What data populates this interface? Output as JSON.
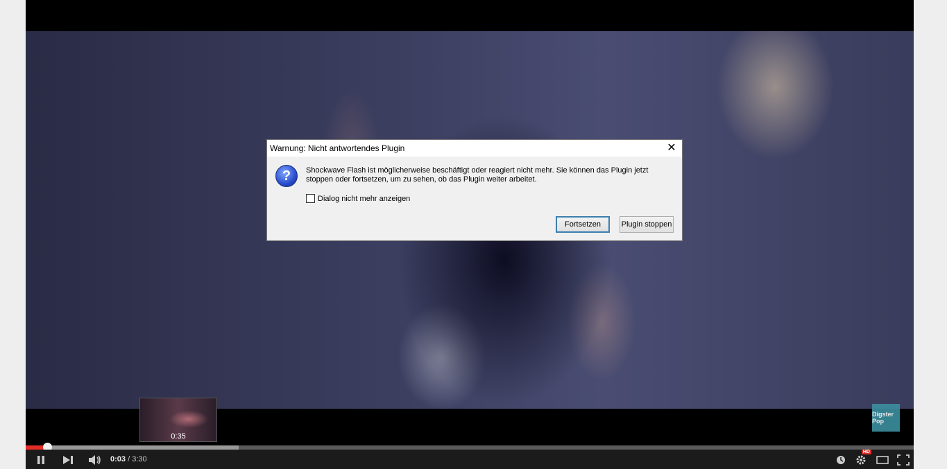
{
  "video": {
    "hover_preview_time": "0:35",
    "watermark_text": "Digster Pop",
    "progress": {
      "played_fraction": 0.024,
      "buffered_fraction": 0.24
    }
  },
  "controls": {
    "current_time": "0:03",
    "separator": " / ",
    "duration": "3:30",
    "hd_badge": "HD",
    "icons": [
      "pause-icon",
      "next-icon",
      "volume-icon",
      "watch-later-icon",
      "gear-icon",
      "theater-mode-icon",
      "fullscreen-icon"
    ]
  },
  "dialog": {
    "title": "Warnung: Nicht antwortendes Plugin",
    "message": "Shockwave Flash ist möglicherweise beschäftigt oder reagiert nicht mehr. Sie können das Plugin jetzt stoppen oder fortsetzen, um zu sehen, ob das Plugin weiter arbeitet.",
    "checkbox_label": "Dialog nicht mehr anzeigen",
    "checkbox_checked": false,
    "continue_label": "Fortsetzen",
    "stop_label": "Plugin stoppen",
    "icon": "question-icon"
  },
  "colors": {
    "progress_played": "#e52d27",
    "dialog_bg": "#f0f0f0",
    "default_button_border": "#3c7fb1"
  }
}
